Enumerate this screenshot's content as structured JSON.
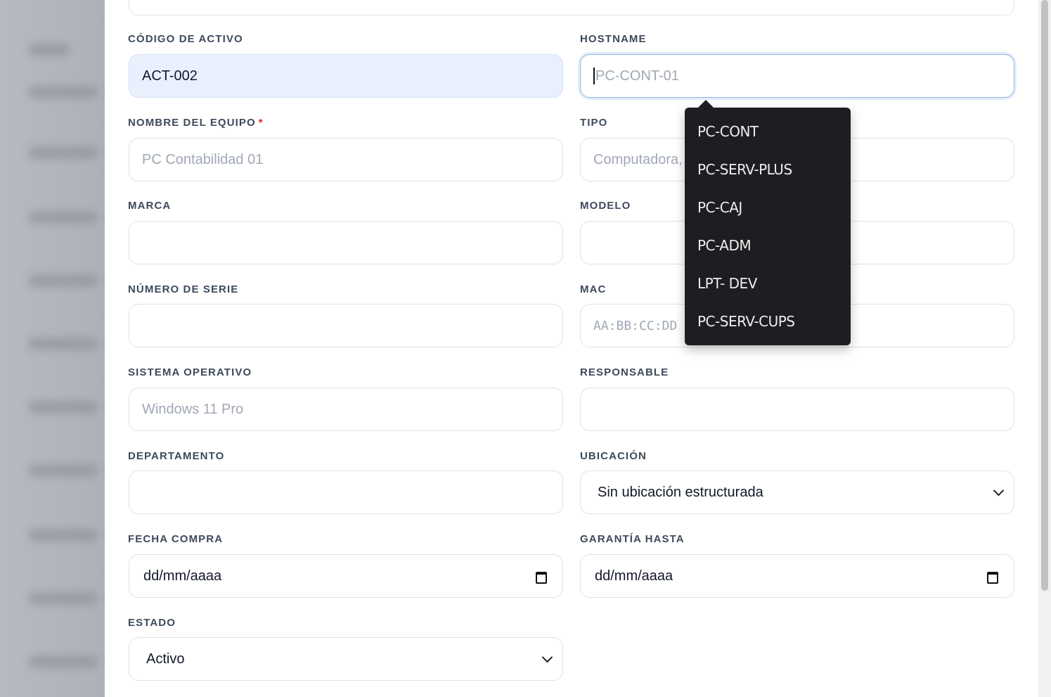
{
  "form": {
    "codigo": {
      "label": "CÓDIGO DE ACTIVO",
      "value": "ACT-002"
    },
    "hostname": {
      "label": "HOSTNAME",
      "placeholder": "PC-CONT-01"
    },
    "nombre": {
      "label": "NOMBRE DEL EQUIPO",
      "required_mark": "*",
      "placeholder": "PC Contabilidad 01"
    },
    "tipo": {
      "label": "TIPO",
      "placeholder": "Computadora,"
    },
    "marca": {
      "label": "MARCA"
    },
    "modelo": {
      "label": "MODELO"
    },
    "serie": {
      "label": "NÚMERO DE SERIE"
    },
    "mac": {
      "label": "MAC",
      "placeholder": "AA:BB:CC:DD"
    },
    "so": {
      "label": "SISTEMA OPERATIVO",
      "placeholder": "Windows 11 Pro"
    },
    "responsable": {
      "label": "RESPONSABLE"
    },
    "departamento": {
      "label": "DEPARTAMENTO"
    },
    "ubicacion": {
      "label": "UBICACIÓN",
      "value": "Sin ubicación estructurada"
    },
    "fecha_compra": {
      "label": "FECHA COMPRA",
      "value": "dd/mm/aaaa"
    },
    "garantia": {
      "label": "GARANTÍA HASTA",
      "value": "dd/mm/aaaa"
    },
    "estado": {
      "label": "ESTADO",
      "value": "Activo"
    }
  },
  "autocomplete": {
    "options": [
      "PC-CONT",
      "PC-SERV-PLUS",
      "PC-CAJ",
      "PC-ADM",
      "LPT- DEV",
      "PC-SERV-CUPS"
    ]
  },
  "colors": {
    "label": "#3d4a5c",
    "required": "#e02424",
    "filled_field_bg": "#e8f0fe",
    "dropdown_bg": "#1e1d22"
  }
}
